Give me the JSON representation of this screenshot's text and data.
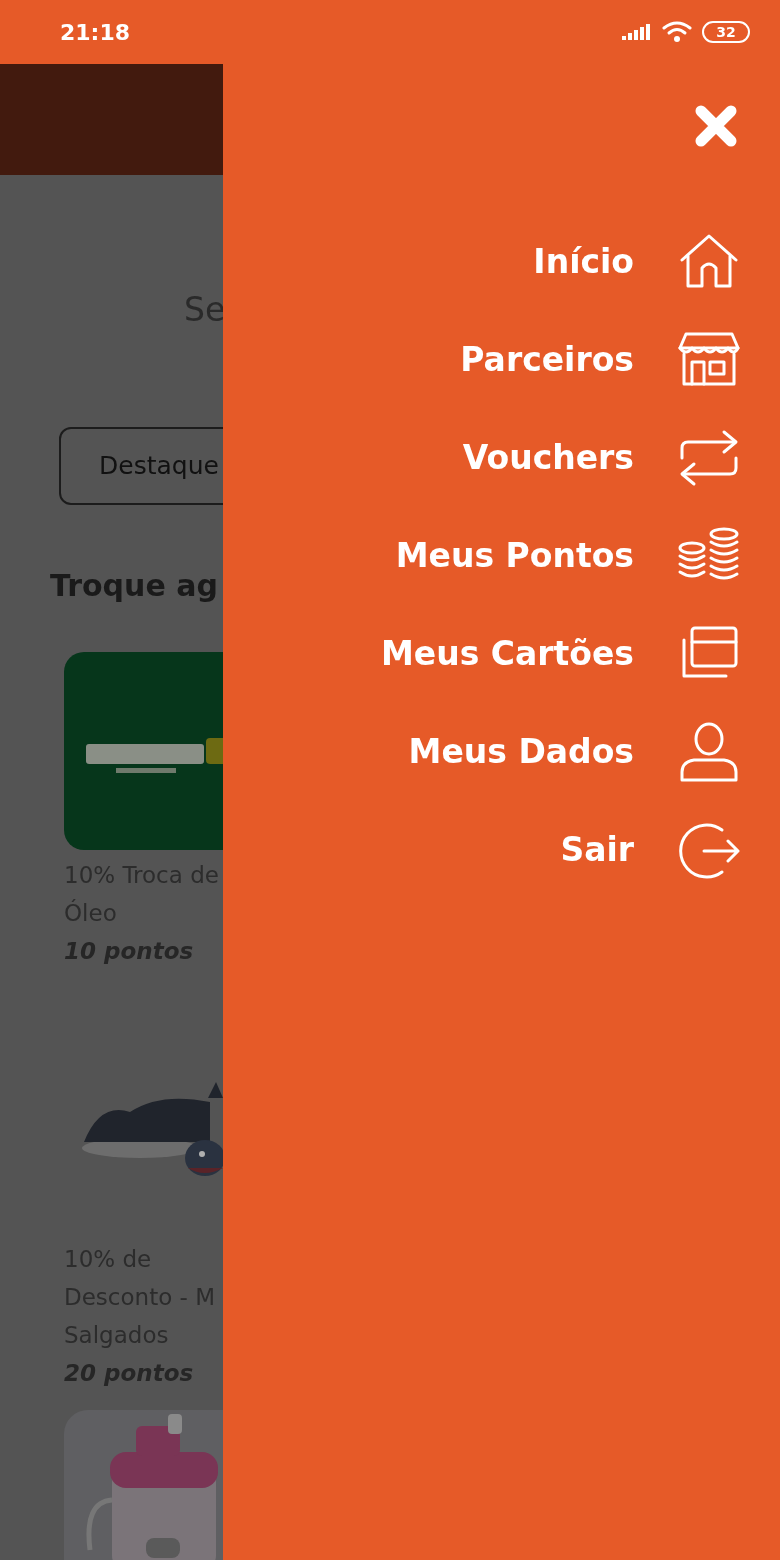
{
  "status_bar": {
    "time": "21:18",
    "battery": "32"
  },
  "background": {
    "heading": "Se",
    "filter_button": "Destaque",
    "section_title": "Troque ag",
    "offers": [
      {
        "kind": "picture",
        "lines": [
          "10% Troca de",
          "Óleo"
        ],
        "points": "10 pontos"
      },
      {
        "kind": "picture",
        "lines": [
          "10% de",
          "Desconto - M",
          "Salgados"
        ],
        "points": "20 pontos"
      },
      {
        "kind": "picture"
      }
    ]
  },
  "drawer": {
    "items": [
      {
        "label": "Início"
      },
      {
        "label": "Parceiros"
      },
      {
        "label": "Vouchers"
      },
      {
        "label": "Meus Pontos"
      },
      {
        "label": "Meus Cartões"
      },
      {
        "label": "Meus Dados"
      },
      {
        "label": "Sair"
      }
    ]
  }
}
